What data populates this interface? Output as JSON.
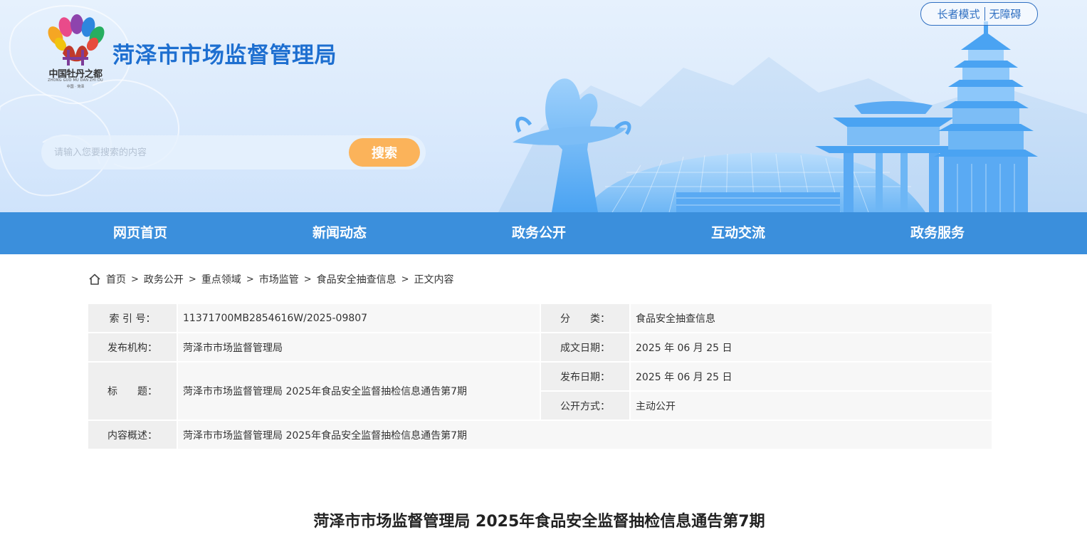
{
  "header": {
    "logo_text": "中国牡丹之都",
    "logo_en": "ZHONG GUO MU DAN ZHI DU",
    "logo_sub": "中国 · 菏泽",
    "site_title": "菏泽市市场监督管理局",
    "accessibility": {
      "elder_mode": "长者模式",
      "barrier_free": "无障碍"
    },
    "search": {
      "placeholder": "请输入您要搜索的内容",
      "button": "搜索"
    }
  },
  "nav": {
    "items": [
      {
        "label": "网页首页"
      },
      {
        "label": "新闻动态"
      },
      {
        "label": "政务公开"
      },
      {
        "label": "互动交流"
      },
      {
        "label": "政务服务"
      }
    ]
  },
  "breadcrumb": {
    "home_icon": "home-icon",
    "items": [
      "首页",
      "政务公开",
      "重点领域",
      "市场监管",
      "食品安全抽查信息",
      "正文内容"
    ],
    "separator": ">"
  },
  "info": {
    "index_label": "索 引 号：",
    "index_value": "11371700MB2854616W/2025-09807",
    "category_label": "分　　类：",
    "category_value": "食品安全抽查信息",
    "publisher_label": "发布机构：",
    "publisher_value": "菏泽市市场监督管理局",
    "created_label": "成文日期：",
    "created_value": "2025 年 06 月 25 日",
    "title_label": "标　　题：",
    "title_value": "菏泽市市场监督管理局 2025年食品安全监督抽检信息通告第7期",
    "published_label": "发布日期：",
    "published_value": "2025 年 06 月 25 日",
    "disclosure_label": "公开方式：",
    "disclosure_value": "主动公开",
    "summary_label": "内容概述：",
    "summary_value": "菏泽市市场监督管理局 2025年食品安全监督抽检信息通告第7期"
  },
  "article": {
    "title": "菏泽市市场监督管理局 2025年食品安全监督抽检信息通告第7期"
  },
  "colors": {
    "nav_bg": "#3b8fdc",
    "title_blue": "#1e6fd0",
    "search_button": "#fbb35a",
    "access_border": "#2f6fc1"
  }
}
